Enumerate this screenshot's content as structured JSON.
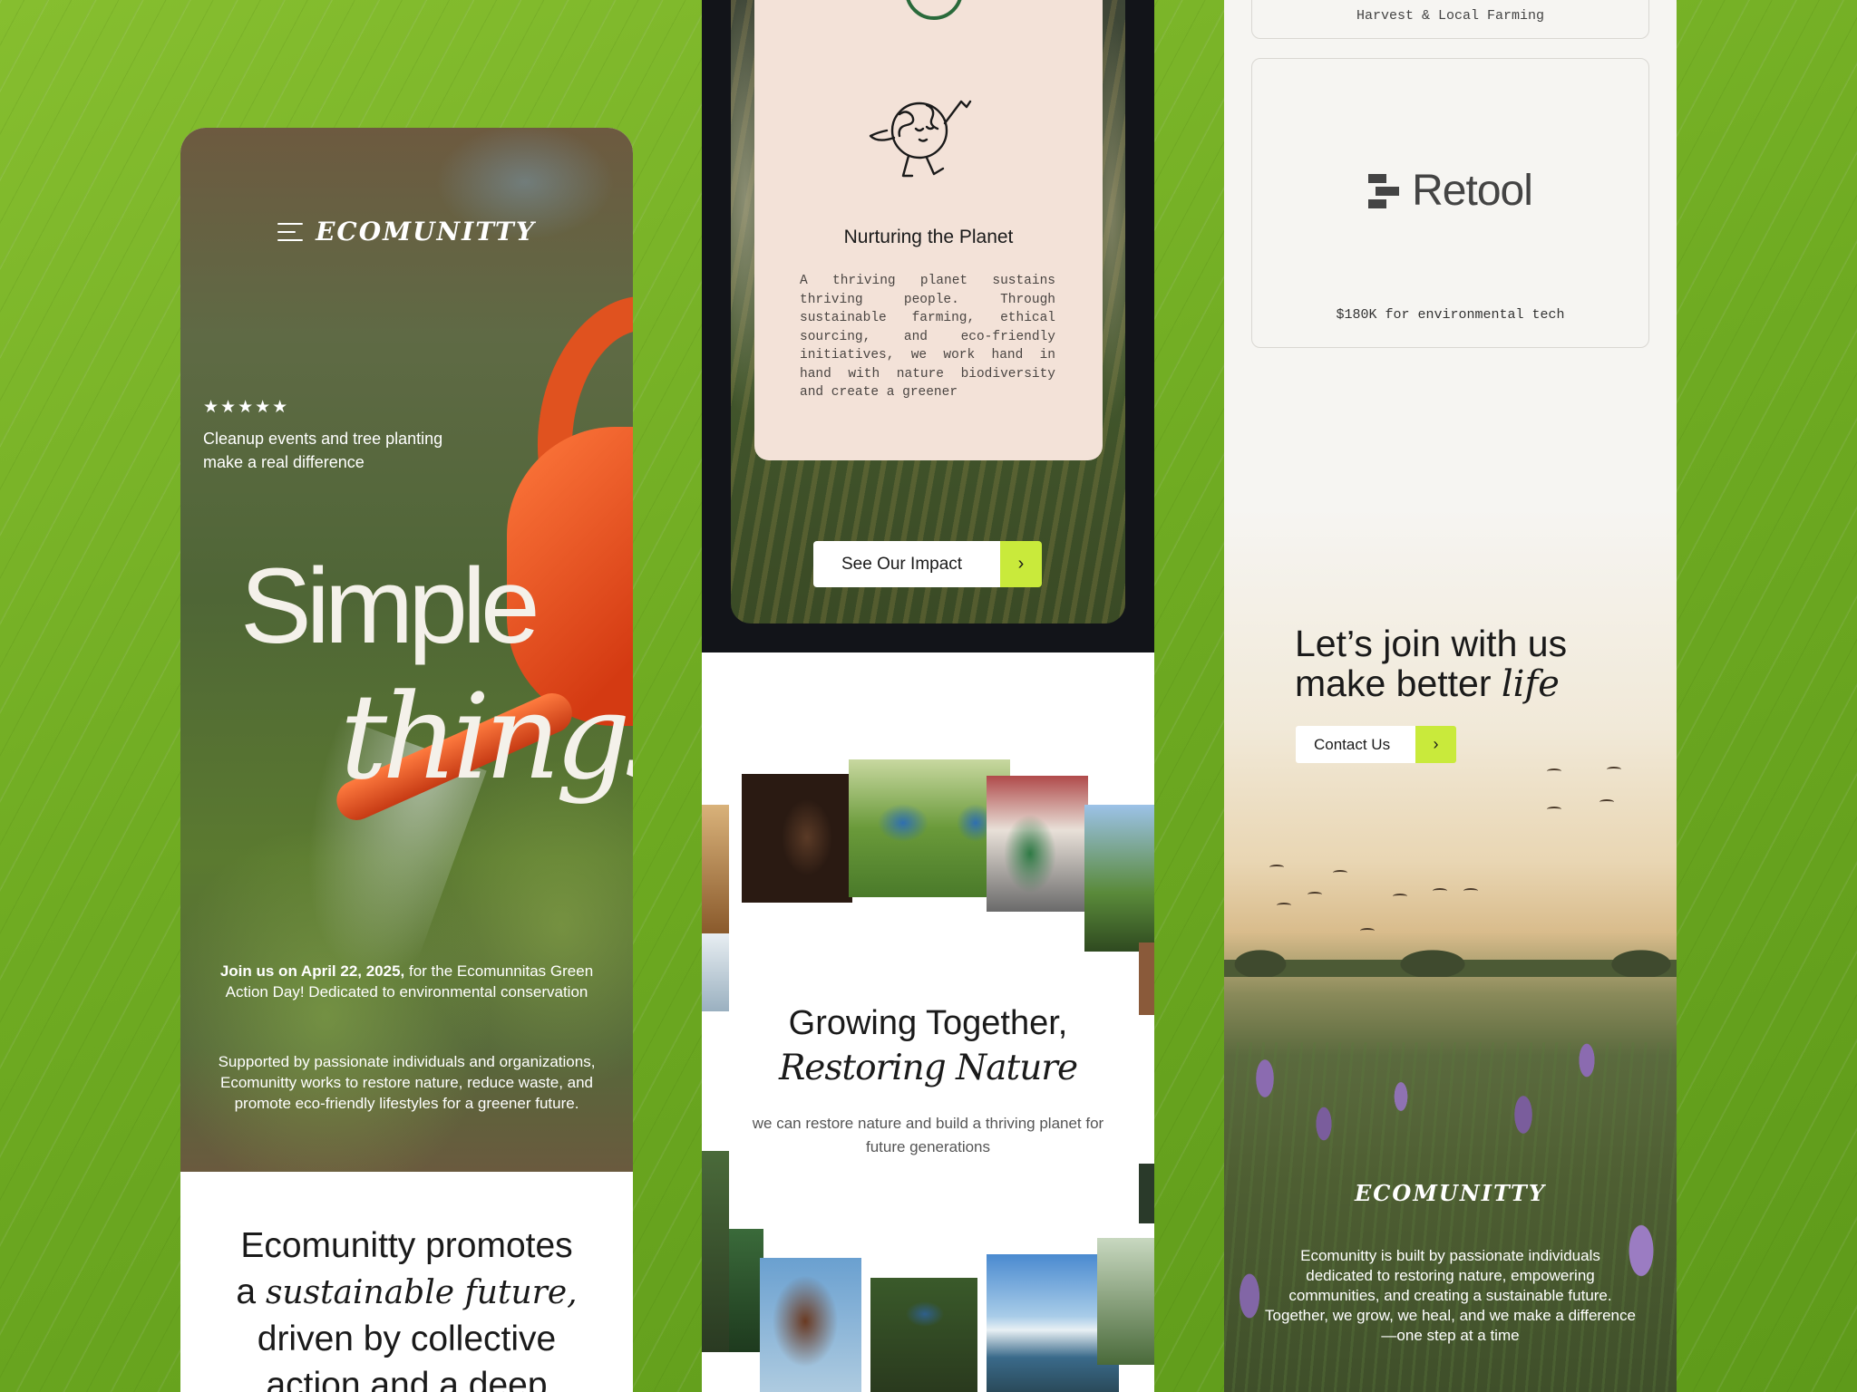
{
  "left": {
    "brand": "ECOMUNITTY",
    "stars": "★★★★★",
    "tagline": "Cleanup events and tree planting make a real difference",
    "hero_word1": "Simple",
    "hero_word2": "things",
    "join_bold": "Join us on April 22, 2025,",
    "join_rest": " for the Ecomunnitas Green Action Day! Dedicated to environmental conservation",
    "support": "Supported by passionate individuals and organizations, Ecomunitty works to restore nature, reduce waste, and promote eco-friendly lifestyles for a greener future.",
    "promote_1": "Ecomunitty promotes",
    "promote_a": "a ",
    "promote_it": "sustainable future,",
    "promote_2": "driven by collective",
    "promote_3": "action and a deep"
  },
  "middle": {
    "card_title": "Nurturing the Planet",
    "card_text": "A thriving planet sustains thriving people. Through sustainable farming, ethical sourcing, and eco-friendly initiatives, we work hand in hand with nature biodiversity and create a greener",
    "impact_button": "See Our Impact",
    "arrow": "›",
    "growing_title": "Growing Together,",
    "growing_sub": "Restoring Nature",
    "growing_text": "we can restore nature and build a thriving planet for future generations"
  },
  "right": {
    "top_box_text": "Harvest & Local Farming",
    "sponsor_name": "Retool",
    "sponsor_text": "$180K for environmental tech",
    "lets_line1": "Let’s join with us",
    "lets_line2": "make better ",
    "lets_italic": "life",
    "contact_button": "Contact Us",
    "arrow": "›",
    "brand": "ECOMUNITTY",
    "about": "Ecomunitty is built by passionate individuals dedicated to restoring nature, empowering communities, and creating a sustainable future. Together, we grow, we heal, and we make a difference—one step at a time"
  },
  "colors": {
    "background_green": "#6fab22",
    "accent_lime": "#c9ea3b",
    "card_peach": "#f3e2d8",
    "dark_band": "#121419"
  }
}
